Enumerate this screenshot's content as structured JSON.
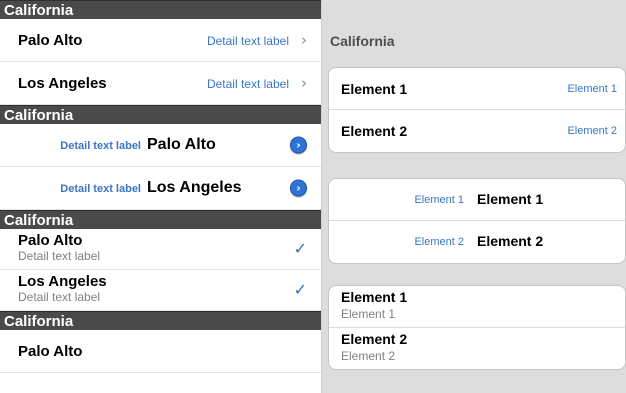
{
  "left": {
    "sections": [
      {
        "header": "California"
      },
      {
        "header": "California"
      },
      {
        "header": "California"
      },
      {
        "header": "California"
      }
    ],
    "value1_rows": [
      {
        "title": "Palo Alto",
        "detail": "Detail text label"
      },
      {
        "title": "Los Angeles",
        "detail": "Detail text label"
      }
    ],
    "value2_rows": [
      {
        "detail": "Detail text label",
        "title": "Palo Alto"
      },
      {
        "detail": "Detail text label",
        "title": "Los Angeles"
      }
    ],
    "subtitle_rows": [
      {
        "title": "Palo Alto",
        "subtitle": "Detail text label"
      },
      {
        "title": "Los Angeles",
        "subtitle": "Detail text label"
      }
    ],
    "default_rows": [
      {
        "title": "Palo Alto"
      }
    ],
    "icons": {
      "chevron": "›",
      "disclosure": "›",
      "checkmark": "✓"
    }
  },
  "right": {
    "title": "California",
    "group1": [
      {
        "title": "Element 1",
        "detail": "Element 1"
      },
      {
        "title": "Element 2",
        "detail": "Element 2"
      }
    ],
    "group2": [
      {
        "detail": "Element 1",
        "title": "Element 1"
      },
      {
        "detail": "Element 2",
        "title": "Element 2"
      }
    ],
    "group3": [
      {
        "title": "Element 1",
        "subtitle": "Element 1"
      },
      {
        "title": "Element 2",
        "subtitle": "Element 2"
      }
    ]
  },
  "colors": {
    "section_header_bg": "#4a4a4a",
    "detail_blue": "#3a75c4",
    "disclosure_blue": "#2f73d6",
    "grouped_bg": "#dddddd"
  }
}
